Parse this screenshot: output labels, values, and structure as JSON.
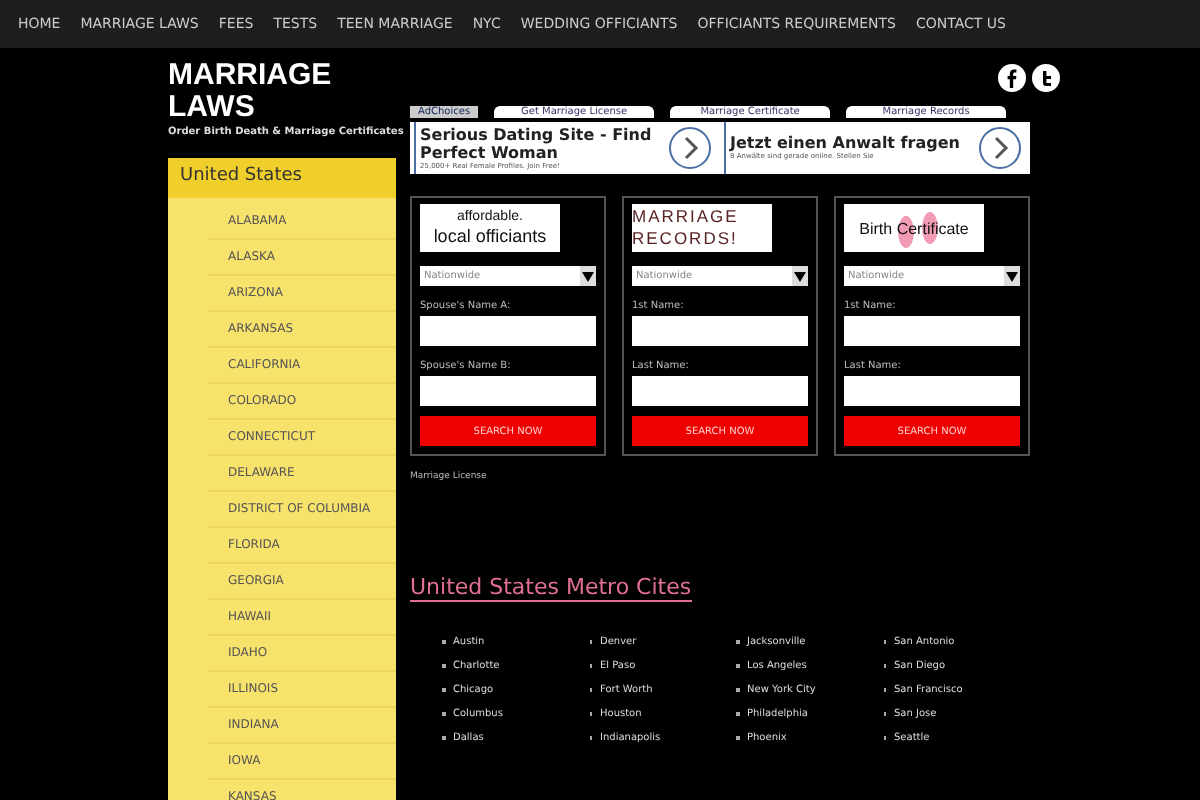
{
  "nav": [
    "HOME",
    "MARRIAGE LAWS",
    "FEES",
    "TESTS",
    "TEEN MARRIAGE",
    "NYC",
    "WEDDING OFFICIANTS",
    "OFFICIANTS REQUIREMENTS",
    "CONTACT US"
  ],
  "logo": {
    "title": "MARRIAGE LAWS",
    "tagline": "Order Birth Death & Marriage Certificates"
  },
  "sidebar": {
    "heading": "United States",
    "items": [
      "ALABAMA",
      "ALASKA",
      "ARIZONA",
      "ARKANSAS",
      "CALIFORNIA",
      "COLORADO",
      "CONNECTICUT",
      "DELAWARE",
      "DISTRICT OF COLUMBIA",
      "FLORIDA",
      "GEORGIA",
      "HAWAII",
      "IDAHO",
      "ILLINOIS",
      "INDIANA",
      "IOWA",
      "KANSAS"
    ]
  },
  "ad_links": {
    "choices": "AdChoices",
    "links": [
      "Get Marriage License",
      "Marriage Certificate",
      "Marriage Records"
    ]
  },
  "ads": [
    {
      "title": "Serious Dating Site - Find Perfect Woman",
      "sub": "25,000+ Real Female Profiles. Join Free!"
    },
    {
      "title": "Jetzt einen Anwalt fragen",
      "sub": "8 Anwälte sind gerade online. Stellen Sie"
    }
  ],
  "forms": [
    {
      "kind": "officiants",
      "banner": [
        "affordable.",
        "local officiants"
      ],
      "select": "Nationwide",
      "label_1": "Spouse's Name A:",
      "label_2": "Spouse's Name B:",
      "button": "SEARCH NOW"
    },
    {
      "kind": "records",
      "banner": [
        "MARRIAGE",
        "RECORDS!"
      ],
      "select": "Nationwide",
      "label_1": "1st Name:",
      "label_2": "Last Name:",
      "button": "SEARCH NOW"
    },
    {
      "kind": "birth",
      "banner": [
        "Birth Certificate"
      ],
      "select": "Nationwide",
      "label_1": "1st Name:",
      "label_2": "Last Name:",
      "button": "SEARCH NOW"
    }
  ],
  "note": "Marriage License",
  "metro": {
    "title": "United States Metro Cites",
    "columns": [
      [
        "Austin",
        "Charlotte",
        "Chicago",
        "Columbus",
        "Dallas"
      ],
      [
        "Denver",
        "El Paso",
        "Fort Worth",
        "Houston",
        "Indianapolis"
      ],
      [
        "Jacksonville",
        "Los Angeles",
        "New York City",
        "Philadelphia",
        "Phoenix"
      ],
      [
        "San Antonio",
        "San Diego",
        "San Francisco",
        "San Jose",
        "Seattle"
      ]
    ]
  }
}
